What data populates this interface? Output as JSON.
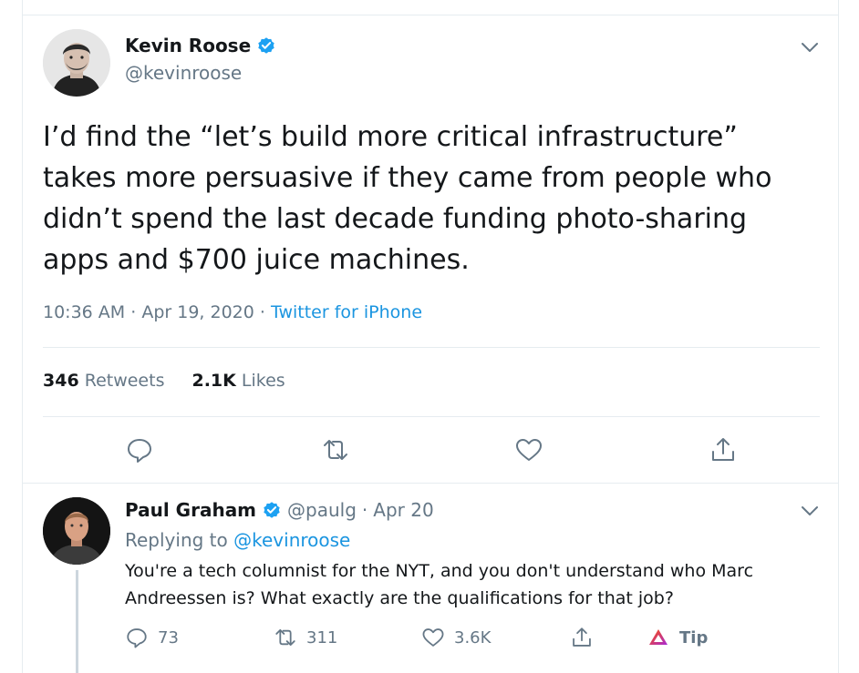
{
  "tweet": {
    "author_name": "Kevin Roose",
    "author_handle": "@kevinroose",
    "text": "I’d find the “let’s build more critical infrastructure”\ntakes more persuasive if they came from people who\ndidn’t spend the last decade funding photo-sharing\napps and $700 juice machines.",
    "time": "10:36 AM",
    "separator": "·",
    "date": "Apr 19, 2020",
    "source": "Twitter for iPhone",
    "retweets_count": "346",
    "retweets_label": "Retweets",
    "likes_count": "2.1K",
    "likes_label": "Likes"
  },
  "reply": {
    "author_name": "Paul Graham",
    "author_handle": "@paulg",
    "separator": "·",
    "date": "Apr 20",
    "replying_prefix": "Replying to",
    "replying_to": "@kevinroose",
    "text": "You're a tech columnist for the NYT, and you don't understand who Marc Andreessen is? What exactly are the qualifications for that job?",
    "reply_count": "73",
    "retweet_count": "311",
    "like_count": "3.6K",
    "tip_label": "Tip"
  },
  "icons": {
    "verified": "verified-badge-icon",
    "caret": "chevron-down-icon",
    "reply": "speech-bubble-icon",
    "retweet": "retweet-arrows-icon",
    "like": "heart-icon",
    "share": "share-upload-icon",
    "tip": "brave-tip-triangle-icon"
  },
  "colors": {
    "text": "#14171a",
    "muted": "#657786",
    "link": "#1b95e0",
    "verified": "#1da1f2",
    "divider": "#e6ecf0",
    "tip_gradient_start": "#ff5000",
    "tip_gradient_end": "#a729d6"
  }
}
